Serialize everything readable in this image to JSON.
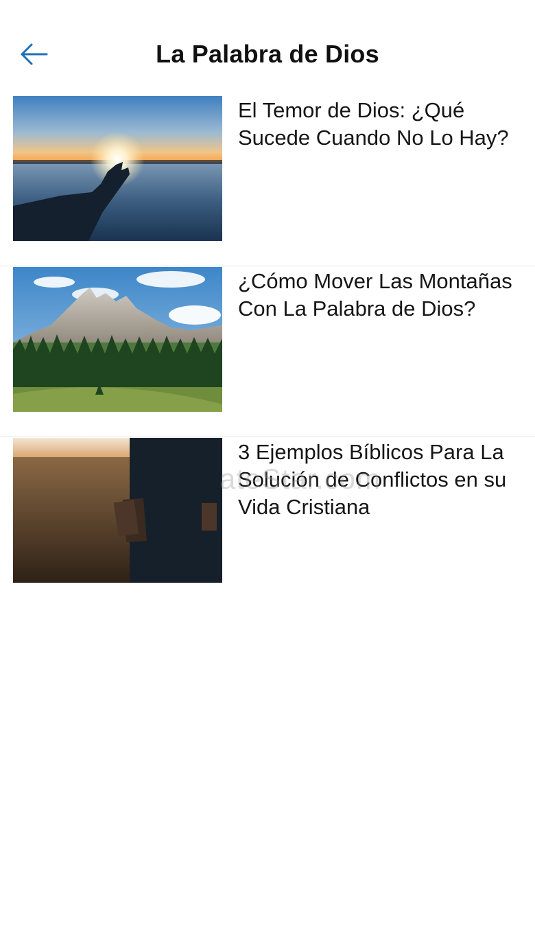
{
  "header": {
    "title": "La Palabra de Dios",
    "back_icon": "arrow-left-icon",
    "accent_color": "#1f6fb5"
  },
  "articles": [
    {
      "title": "El Temor de Dios: ¿Qué Sucede Cuando No Lo Hay?",
      "image": "sunset-hand-reaching-image"
    },
    {
      "title": "¿Cómo Mover Las Montañas Con La Palabra de Dios?",
      "image": "mountain-forest-image"
    },
    {
      "title": "3 Ejemplos Bíblicos Para La Solución de Conflictos en su Vida Cristiana",
      "image": "person-holding-bible-field-image"
    }
  ],
  "watermark": "ateStar.com"
}
